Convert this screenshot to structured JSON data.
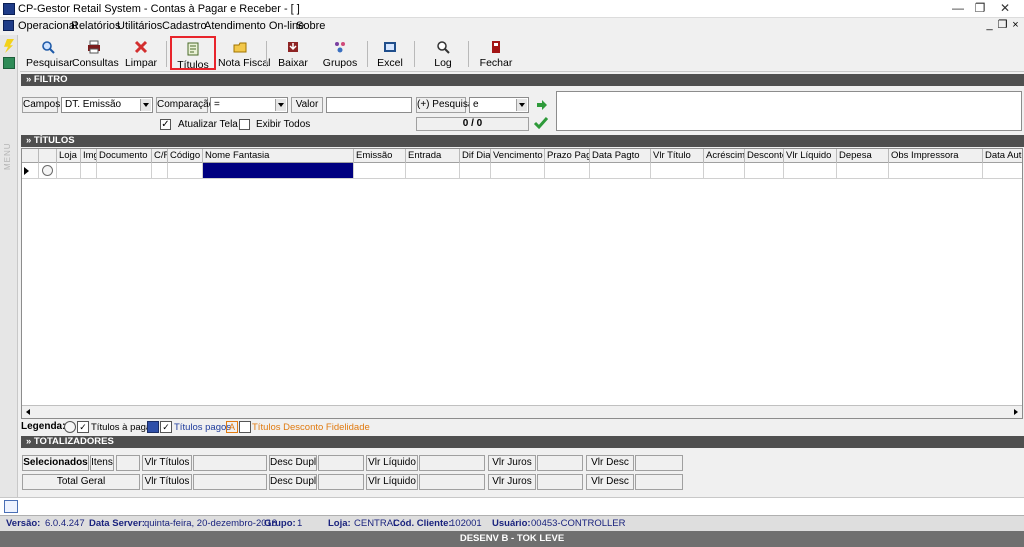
{
  "window": {
    "title": "CP-Gestor Retail System - Contas à Pagar e Receber - [ ]",
    "controls": {
      "minimize": "—",
      "maximize": "❐",
      "close": "✕"
    }
  },
  "menu": {
    "items": [
      "Operacional",
      "Relatórios",
      "Utilitários",
      "Cadastro",
      "Atendimento On-line",
      "Sobre"
    ],
    "mdi_controls": {
      "minimize": "_",
      "restore": "❐",
      "close": "×"
    }
  },
  "sidebar": {
    "vertical_label": "MENU"
  },
  "toolbar": {
    "buttons": [
      {
        "label": "Pesquisar",
        "icon": "search-icon",
        "color": "#1e5aa8"
      },
      {
        "label": "Consultas",
        "icon": "printer-icon",
        "color": "#7b1c1c"
      },
      {
        "label": "Limpar",
        "icon": "clear-icon",
        "color": "#d32f2f"
      },
      {
        "label": "Títulos",
        "icon": "titles-icon",
        "color": "#4a6b2a"
      },
      {
        "label": "Nota Fiscal",
        "icon": "invoice-icon",
        "color": "#d8a200"
      },
      {
        "label": "Baixar",
        "icon": "download-icon",
        "color": "#8e2424"
      },
      {
        "label": "Grupos",
        "icon": "groups-icon",
        "color": "#7a3fa0"
      },
      {
        "label": "Excel",
        "icon": "excel-icon",
        "color": "#1f4e8c"
      },
      {
        "label": "Log",
        "icon": "log-icon",
        "color": "#333333"
      },
      {
        "label": "Fechar",
        "icon": "close-door-icon",
        "color": "#a31515"
      }
    ],
    "highlight_color": "#e8242b"
  },
  "filter": {
    "header": "» FILTRO",
    "campos_label": "Campos",
    "campos_value": "DT. Emissão",
    "comparacao_label": "Comparação",
    "comparacao_value": "=",
    "valor_label": "Valor",
    "valor_value": "",
    "pesquisa_label": "(+) Pesquisa",
    "pesquisa_value": "e",
    "atualizar_tela_label": "Atualizar Tela",
    "atualizar_tela_checked": "✓",
    "exibir_todos_label": "Exibir Todos",
    "exibir_todos_checked": "",
    "counter": "0 / 0"
  },
  "titulos": {
    "header": "» TÍTULOS",
    "columns": [
      "Loja",
      "Img",
      "Documento",
      "C/F",
      "Código",
      "Nome Fantasia",
      "Emissão",
      "Entrada",
      "Dif Dias",
      "Vencimento",
      "Prazo Pagto",
      "Data Pagto",
      "Vlr Título",
      "Acréscimo",
      "Desconto",
      "Vlr Líquido",
      "Depesa",
      "Obs Impressora",
      "Data Autori"
    ]
  },
  "legend": {
    "label": "Legenda:",
    "items": [
      {
        "text": "Títulos à pagar",
        "color": "#000000"
      },
      {
        "text": "Títulos pagos",
        "color": "#1f3c9c"
      },
      {
        "text": "Títulos Desconto Fidelidade",
        "color": "#e07a10"
      }
    ],
    "marker_A": "A"
  },
  "totalizadores": {
    "header": "» TOTALIZADORES",
    "selecionados_label": "Selecionados",
    "itens_label": "Itens",
    "total_geral_label": "Total Geral",
    "vlr_titulos_label": "Vlr Títulos",
    "desc_dupl_label": "Desc Dupl",
    "vlr_liquido_label": "Vlr Líquido",
    "vlr_juros_label": "Vlr Juros",
    "vlr_desc_label": "Vlr Desc"
  },
  "status": {
    "versao_label": "Versão:",
    "versao": "6.0.4.247",
    "data_server_label": "Data Server:",
    "data_server": "quinta-feira, 20-dezembro-2018",
    "grupo_label": "Grupo:",
    "grupo": "1",
    "loja_label": "Loja:",
    "loja": "CENTRAL",
    "cod_cliente_label": "Cód. Cliente:",
    "cod_cliente": "102001",
    "usuario_label": "Usuário:",
    "usuario": "00453-CONTROLLER",
    "environment": "DESENV B - TOK LEVE"
  }
}
